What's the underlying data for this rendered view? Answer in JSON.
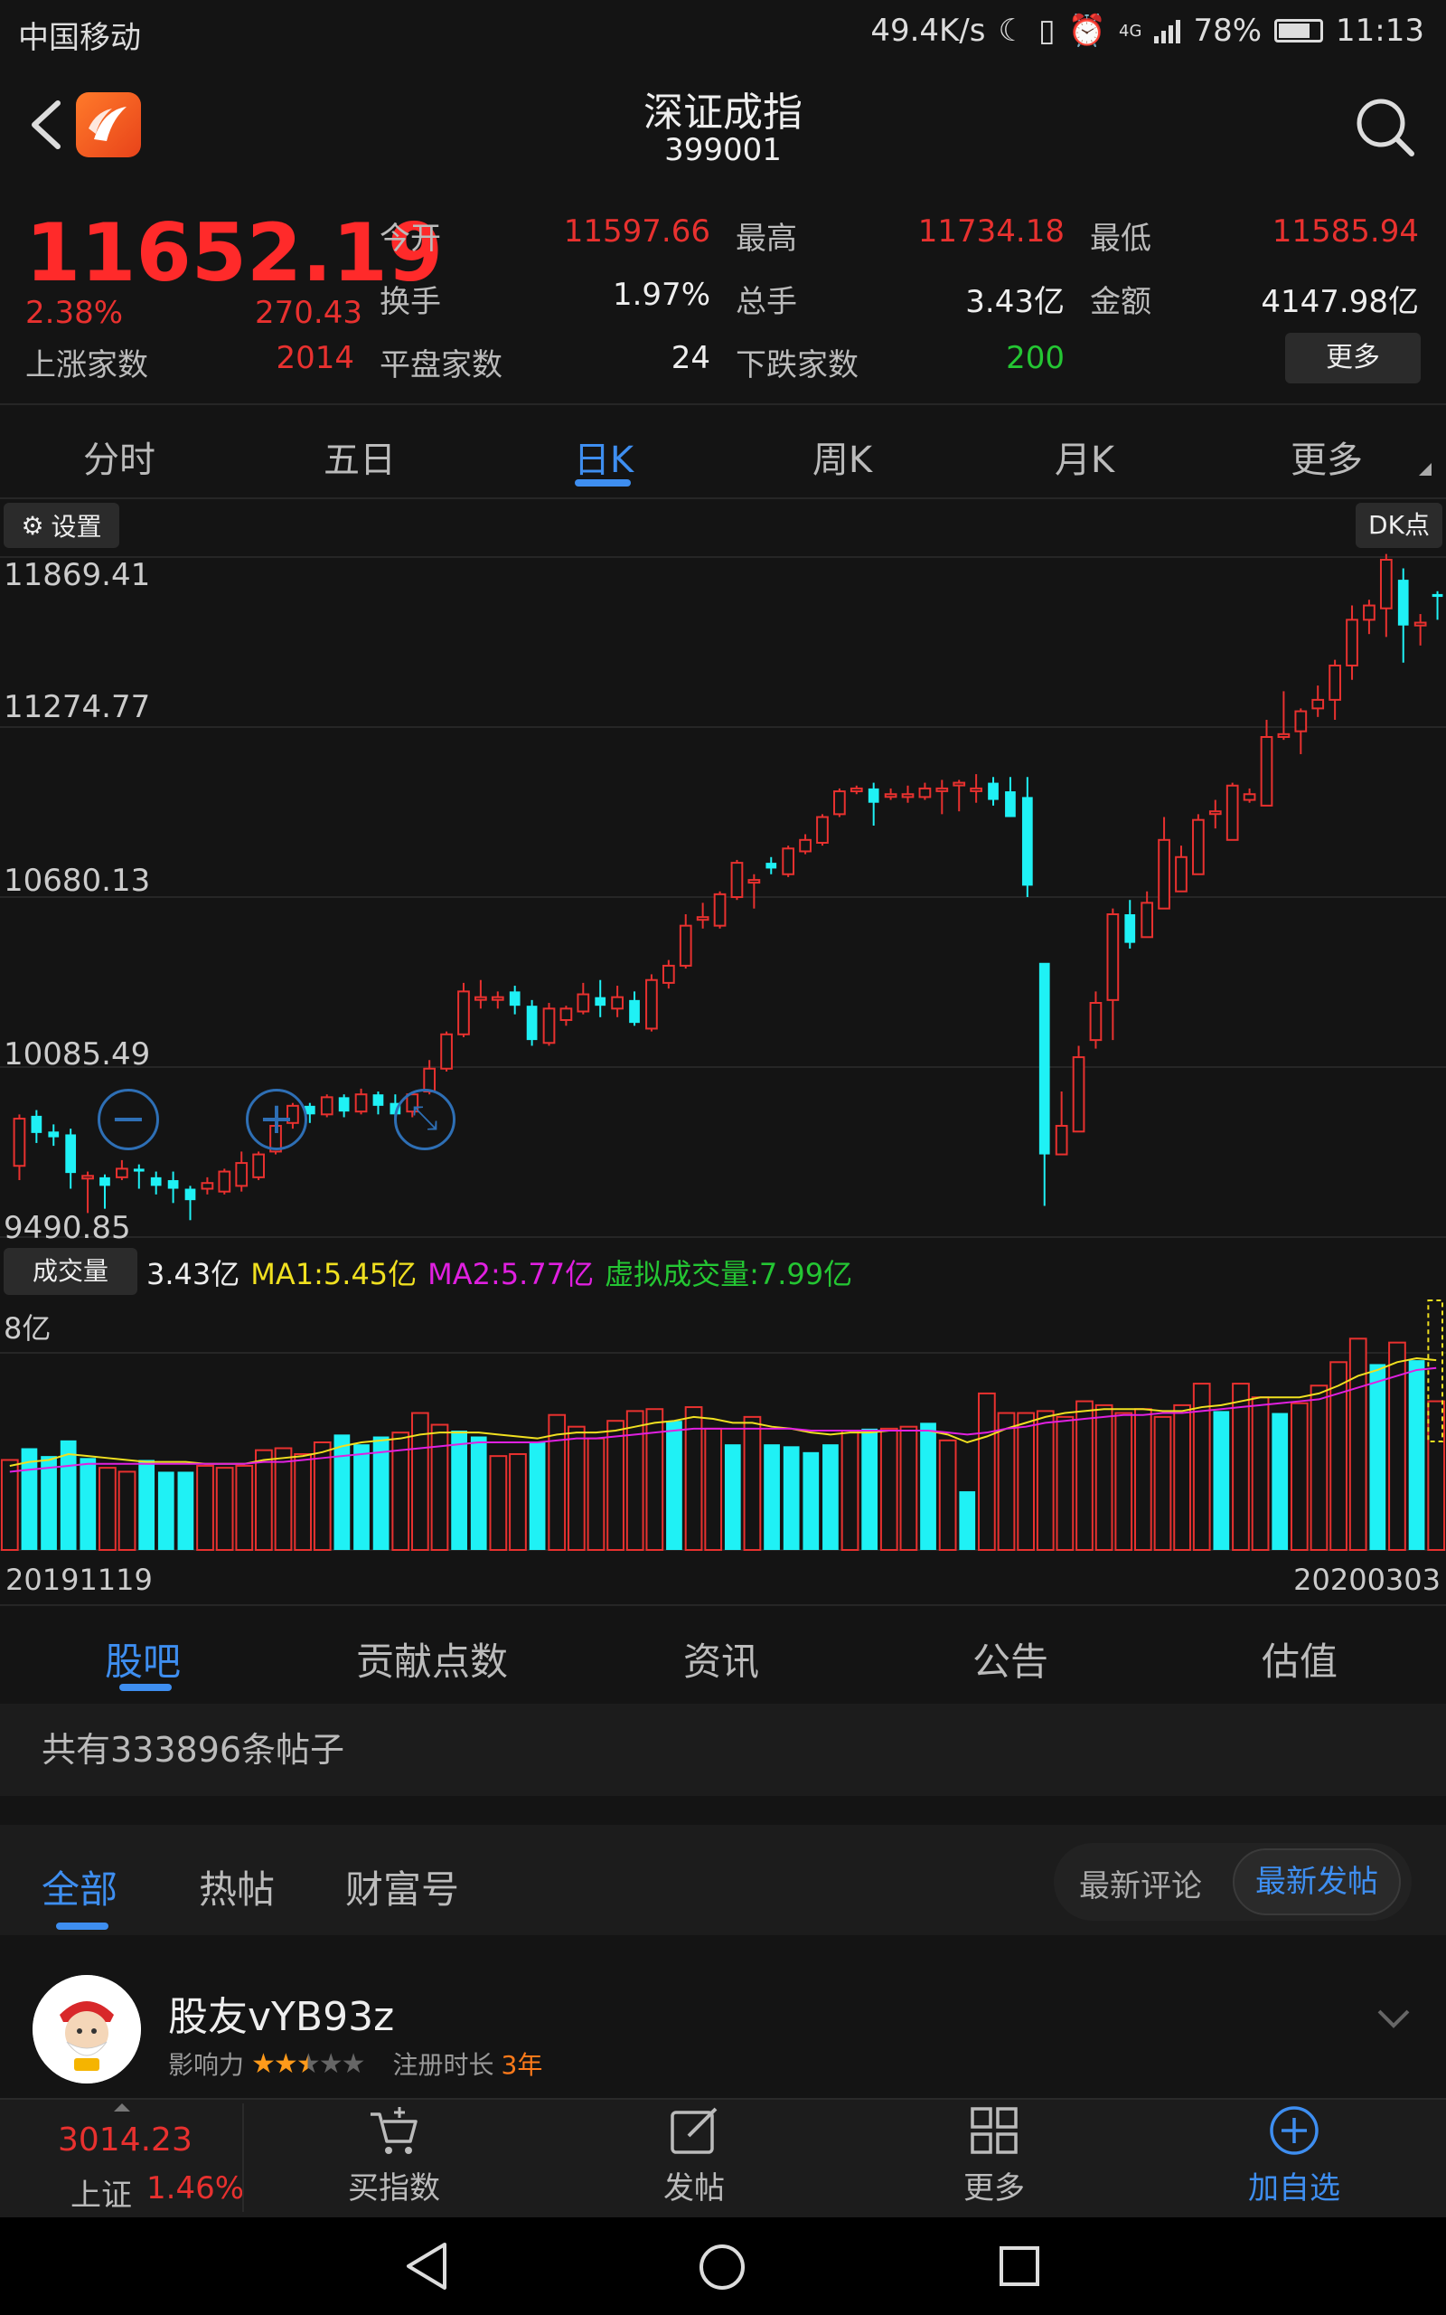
{
  "status_bar": {
    "carrier": "中国移动",
    "speed": "49.4K/s",
    "battery": "78%",
    "time": "11:13",
    "net": "4G"
  },
  "header": {
    "title": "深证成指",
    "code": "399001"
  },
  "quote": {
    "price": "11652.19",
    "change_pct": "2.38%",
    "change": "270.43",
    "open_label": "今开",
    "open": "11597.66",
    "high_label": "最高",
    "high": "11734.18",
    "low_label": "最低",
    "low": "11585.94",
    "turnover_label": "换手",
    "turnover": "1.97%",
    "volume_label": "总手",
    "volume": "3.43亿",
    "amount_label": "金额",
    "amount": "4147.98亿",
    "up_label": "上涨家数",
    "up": "2014",
    "flat_label": "平盘家数",
    "flat": "24",
    "down_label": "下跌家数",
    "down": "200",
    "more_label": "更多"
  },
  "kline_tabs": [
    {
      "label": "分时"
    },
    {
      "label": "五日"
    },
    {
      "label": "日K"
    },
    {
      "label": "周K"
    },
    {
      "label": "月K"
    },
    {
      "label": "更多"
    }
  ],
  "chart_controls": {
    "settings": "设置",
    "dk": "DK点"
  },
  "volume_panel": {
    "button": "成交量",
    "vol": "3.43亿",
    "ma1": "MA1:5.45亿",
    "ma2": "MA2:5.77亿",
    "virtual": "虚拟成交量:7.99亿",
    "max_label": "8亿"
  },
  "colors": {
    "up": "#e8312f",
    "down": "#1ff1f5",
    "accent": "#3e8ef0",
    "ma1": "#f0e020",
    "ma2": "#e020e0"
  },
  "chart_data": {
    "type": "candlestick",
    "y_ticks": [
      "11869.41",
      "11274.77",
      "10680.13",
      "10085.49",
      "9490.85"
    ],
    "ylim": [
      9490.85,
      11869.41
    ],
    "x_start": "20191119",
    "x_end": "20200303",
    "candles": [
      [
        9740,
        9905,
        9690,
        9920
      ],
      [
        9915,
        9855,
        9820,
        9935
      ],
      [
        9860,
        9840,
        9810,
        9885
      ],
      [
        9850,
        9715,
        9660,
        9870
      ],
      [
        9700,
        9705,
        9575,
        9720
      ],
      [
        9700,
        9670,
        9590,
        9710
      ],
      [
        9700,
        9730,
        9690,
        9760
      ],
      [
        9730,
        9720,
        9660,
        9745
      ],
      [
        9700,
        9670,
        9640,
        9720
      ],
      [
        9690,
        9660,
        9610,
        9720
      ],
      [
        9660,
        9620,
        9550,
        9670
      ],
      [
        9660,
        9680,
        9640,
        9700
      ],
      [
        9650,
        9720,
        9640,
        9730
      ],
      [
        9670,
        9750,
        9650,
        9790
      ],
      [
        9700,
        9780,
        9690,
        9790
      ],
      [
        9790,
        9880,
        9780,
        9890
      ],
      [
        9890,
        9950,
        9870,
        9960
      ],
      [
        9950,
        9920,
        9890,
        9960
      ],
      [
        9920,
        9980,
        9910,
        9990
      ],
      [
        9980,
        9930,
        9910,
        9990
      ],
      [
        9930,
        9990,
        9920,
        10010
      ],
      [
        9990,
        9950,
        9920,
        10000
      ],
      [
        9960,
        9920,
        9910,
        9990
      ],
      [
        9930,
        9990,
        9910,
        10000
      ],
      [
        10000,
        10080,
        9990,
        10110
      ],
      [
        10080,
        10200,
        10070,
        10210
      ],
      [
        10200,
        10350,
        10190,
        10380
      ],
      [
        10330,
        10330,
        10290,
        10390
      ],
      [
        10330,
        10330,
        10290,
        10350
      ],
      [
        10350,
        10300,
        10270,
        10370
      ],
      [
        10300,
        10180,
        10160,
        10320
      ],
      [
        10170,
        10290,
        10160,
        10310
      ],
      [
        10250,
        10290,
        10230,
        10300
      ],
      [
        10280,
        10340,
        10270,
        10380
      ],
      [
        10330,
        10300,
        10260,
        10390
      ],
      [
        10290,
        10330,
        10260,
        10370
      ],
      [
        10320,
        10240,
        10230,
        10350
      ],
      [
        10220,
        10390,
        10210,
        10410
      ],
      [
        10380,
        10440,
        10360,
        10460
      ],
      [
        10440,
        10580,
        10430,
        10620
      ],
      [
        10610,
        10610,
        10570,
        10660
      ],
      [
        10580,
        10690,
        10570,
        10700
      ],
      [
        10680,
        10800,
        10670,
        10810
      ],
      [
        10740,
        10740,
        10640,
        10760
      ],
      [
        10800,
        10780,
        10760,
        10820
      ],
      [
        10760,
        10850,
        10750,
        10860
      ],
      [
        10840,
        10880,
        10830,
        10900
      ],
      [
        10870,
        10960,
        10860,
        10970
      ],
      [
        10970,
        11050,
        10960,
        11060
      ],
      [
        11050,
        11060,
        11040,
        11070
      ],
      [
        11060,
        11010,
        10930,
        11080
      ],
      [
        11040,
        11040,
        11020,
        11060
      ],
      [
        11030,
        11040,
        11010,
        11070
      ],
      [
        11030,
        11060,
        11020,
        11080
      ],
      [
        11060,
        11060,
        10970,
        11090
      ],
      [
        11080,
        11080,
        10980,
        11090
      ],
      [
        11060,
        11060,
        11010,
        11110
      ],
      [
        11080,
        11020,
        11000,
        11100
      ],
      [
        11050,
        10960,
        10960,
        11100
      ],
      [
        11030,
        10720,
        10680,
        11100
      ],
      [
        10450,
        9780,
        9600,
        10140
      ],
      [
        9780,
        9880,
        9780,
        10000
      ],
      [
        9860,
        10120,
        9860,
        10160
      ],
      [
        10180,
        10310,
        10150,
        10350
      ],
      [
        10320,
        10620,
        10180,
        10640
      ],
      [
        10620,
        10520,
        10500,
        10670
      ],
      [
        10540,
        10660,
        10640,
        10700
      ],
      [
        10640,
        10880,
        10660,
        10960
      ],
      [
        10700,
        10820,
        10780,
        10860
      ],
      [
        10760,
        10950,
        10780,
        10970
      ],
      [
        10980,
        10980,
        10920,
        11020
      ],
      [
        10880,
        11070,
        10930,
        11080
      ],
      [
        11020,
        11040,
        11010,
        11060
      ],
      [
        11000,
        11240,
        11000,
        11300
      ],
      [
        11240,
        11250,
        11230,
        11400
      ],
      [
        11260,
        11330,
        11180,
        11340
      ],
      [
        11340,
        11370,
        11310,
        11420
      ],
      [
        11370,
        11490,
        11300,
        11510
      ],
      [
        11490,
        11650,
        11440,
        11700
      ],
      [
        11650,
        11700,
        11600,
        11720
      ],
      [
        11690,
        11860,
        11590,
        11880
      ],
      [
        11790,
        11630,
        11500,
        11830
      ],
      [
        11630,
        11640,
        11560,
        11670
      ],
      [
        11740,
        11730,
        11650,
        11750
      ]
    ],
    "volume_max_label": "8亿",
    "volumes": [
      {
        "v": 4.6,
        "up": true
      },
      {
        "v": 5.2,
        "up": false
      },
      {
        "v": 4.8,
        "up": false
      },
      {
        "v": 5.6,
        "up": false
      },
      {
        "v": 4.7,
        "up": false
      },
      {
        "v": 4.2,
        "up": true
      },
      {
        "v": 4.0,
        "up": true
      },
      {
        "v": 4.6,
        "up": false
      },
      {
        "v": 4.0,
        "up": false
      },
      {
        "v": 4.0,
        "up": false
      },
      {
        "v": 4.3,
        "up": true
      },
      {
        "v": 4.2,
        "up": true
      },
      {
        "v": 4.3,
        "up": true
      },
      {
        "v": 5.1,
        "up": true
      },
      {
        "v": 5.2,
        "up": true
      },
      {
        "v": 4.9,
        "up": true
      },
      {
        "v": 5.5,
        "up": true
      },
      {
        "v": 5.9,
        "up": false
      },
      {
        "v": 5.4,
        "up": false
      },
      {
        "v": 5.8,
        "up": false
      },
      {
        "v": 6.0,
        "up": true
      },
      {
        "v": 7.0,
        "up": true
      },
      {
        "v": 6.4,
        "up": true
      },
      {
        "v": 6.1,
        "up": false
      },
      {
        "v": 5.8,
        "up": false
      },
      {
        "v": 4.8,
        "up": true
      },
      {
        "v": 4.9,
        "up": true
      },
      {
        "v": 5.5,
        "up": false
      },
      {
        "v": 6.9,
        "up": true
      },
      {
        "v": 6.3,
        "up": true
      },
      {
        "v": 5.7,
        "up": true
      },
      {
        "v": 6.6,
        "up": true
      },
      {
        "v": 7.1,
        "up": true
      },
      {
        "v": 7.2,
        "up": true
      },
      {
        "v": 6.6,
        "up": false
      },
      {
        "v": 7.3,
        "up": true
      },
      {
        "v": 6.2,
        "up": true
      },
      {
        "v": 5.4,
        "up": false
      },
      {
        "v": 6.8,
        "up": true
      },
      {
        "v": 5.4,
        "up": false
      },
      {
        "v": 5.3,
        "up": false
      },
      {
        "v": 5.0,
        "up": false
      },
      {
        "v": 5.4,
        "up": false
      },
      {
        "v": 6.1,
        "up": true
      },
      {
        "v": 6.2,
        "up": false
      },
      {
        "v": 6.2,
        "up": true
      },
      {
        "v": 6.3,
        "up": true
      },
      {
        "v": 6.5,
        "up": false
      },
      {
        "v": 5.6,
        "up": true
      },
      {
        "v": 3.0,
        "up": false
      },
      {
        "v": 8.0,
        "up": true
      },
      {
        "v": 7.0,
        "up": true
      },
      {
        "v": 7.0,
        "up": true
      },
      {
        "v": 7.1,
        "up": true
      },
      {
        "v": 6.8,
        "up": true
      },
      {
        "v": 7.6,
        "up": true
      },
      {
        "v": 7.4,
        "up": true
      },
      {
        "v": 7.0,
        "up": true
      },
      {
        "v": 7.2,
        "up": true
      },
      {
        "v": 6.8,
        "up": true
      },
      {
        "v": 7.4,
        "up": true
      },
      {
        "v": 8.5,
        "up": true
      },
      {
        "v": 7.1,
        "up": false
      },
      {
        "v": 8.5,
        "up": true
      },
      {
        "v": 7.8,
        "up": true
      },
      {
        "v": 7.0,
        "up": false
      },
      {
        "v": 7.5,
        "up": true
      },
      {
        "v": 8.4,
        "up": true
      },
      {
        "v": 9.6,
        "up": true
      },
      {
        "v": 10.8,
        "up": true
      },
      {
        "v": 9.5,
        "up": false
      },
      {
        "v": 10.6,
        "up": true
      },
      {
        "v": 9.7,
        "up": false
      },
      {
        "v": 7.6,
        "up": true
      }
    ],
    "ma1": [
      4.3,
      4.5,
      4.6,
      4.9,
      4.8,
      4.7,
      4.6,
      4.5,
      4.5,
      4.5,
      4.4,
      4.4,
      4.4,
      4.6,
      4.7,
      4.8,
      5.0,
      5.3,
      5.5,
      5.6,
      5.7,
      5.9,
      6.0,
      6.0,
      6.0,
      5.9,
      5.8,
      5.7,
      5.9,
      6.0,
      6.0,
      6.1,
      6.3,
      6.5,
      6.6,
      6.8,
      6.7,
      6.5,
      6.5,
      6.3,
      6.2,
      6.0,
      5.9,
      6.0,
      6.0,
      6.1,
      6.1,
      6.1,
      5.9,
      5.5,
      5.8,
      6.2,
      6.5,
      6.8,
      7.0,
      7.1,
      7.2,
      7.2,
      7.2,
      7.1,
      7.1,
      7.3,
      7.4,
      7.6,
      7.8,
      7.8,
      7.8,
      8.0,
      8.4,
      8.9,
      9.2,
      9.6,
      9.8,
      9.7
    ],
    "ma2": [
      4.0,
      4.1,
      4.2,
      4.3,
      4.4,
      4.4,
      4.4,
      4.4,
      4.4,
      4.4,
      4.4,
      4.4,
      4.4,
      4.5,
      4.5,
      4.6,
      4.7,
      4.8,
      4.9,
      5.0,
      5.1,
      5.2,
      5.3,
      5.4,
      5.5,
      5.5,
      5.5,
      5.5,
      5.6,
      5.7,
      5.7,
      5.8,
      5.9,
      6.0,
      6.1,
      6.2,
      6.2,
      6.2,
      6.2,
      6.2,
      6.2,
      6.1,
      6.1,
      6.1,
      6.1,
      6.1,
      6.1,
      6.1,
      6.0,
      5.9,
      6.0,
      6.2,
      6.3,
      6.5,
      6.6,
      6.7,
      6.8,
      6.9,
      6.9,
      7.0,
      7.0,
      7.1,
      7.2,
      7.3,
      7.4,
      7.5,
      7.6,
      7.7,
      8.0,
      8.3,
      8.6,
      8.9,
      9.2,
      9.3
    ]
  },
  "guba_tabs": [
    {
      "label": "股吧"
    },
    {
      "label": "贡献点数"
    },
    {
      "label": "资讯"
    },
    {
      "label": "公告"
    },
    {
      "label": "估值"
    }
  ],
  "post_count": "共有333896条帖子",
  "filter_tabs": [
    {
      "label": "全部"
    },
    {
      "label": "热帖"
    },
    {
      "label": "财富号"
    }
  ],
  "sort": {
    "latest_comment": "最新评论",
    "latest_post": "最新发帖"
  },
  "post": {
    "user": "股友vYB93z",
    "influence_label": "影响力",
    "stars": 2.5,
    "reg_label": "注册时长",
    "reg_value": "3年"
  },
  "toolbar": {
    "index_price": "3014.23",
    "index_name": "上证",
    "index_pct": "1.46%",
    "buy": "买指数",
    "post": "发帖",
    "more": "更多",
    "add": "加自选"
  }
}
